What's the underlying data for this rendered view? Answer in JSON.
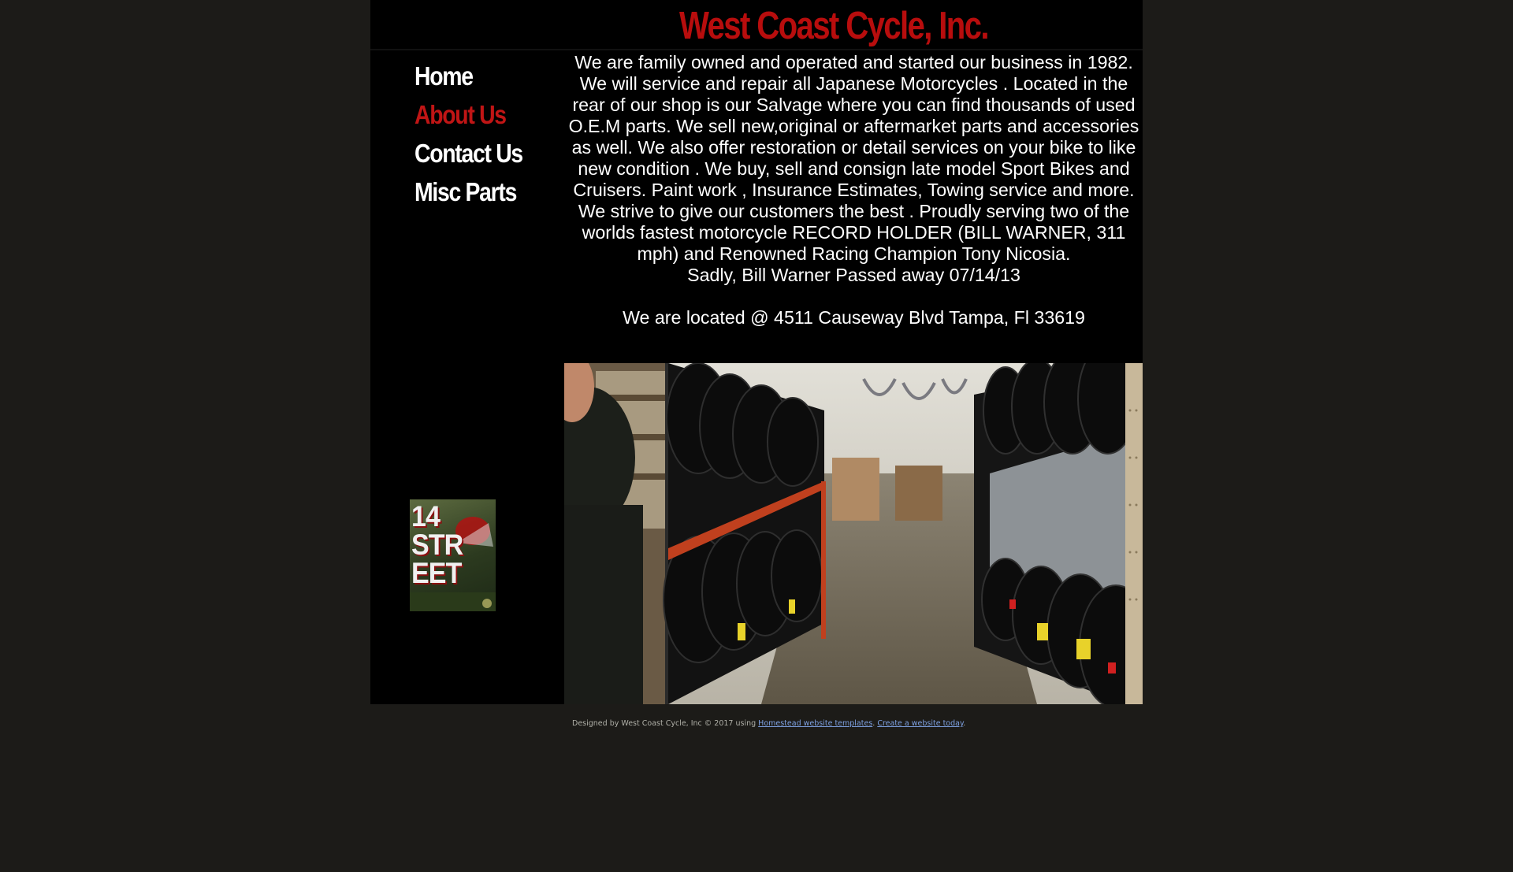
{
  "header": {
    "site_title": "West Coast Cycle, Inc."
  },
  "nav": {
    "items": [
      {
        "label": "Home",
        "active": false
      },
      {
        "label": "About Us",
        "active": true
      },
      {
        "label": "Contact Us",
        "active": false
      },
      {
        "label": "Misc Parts",
        "active": false
      }
    ]
  },
  "about": {
    "paragraph": "We are family owned and operated and  started our business in 1982. We will service and repair all Japanese Motorcycles .  Located in the rear of our shop is our Salvage  where you can find thousands of used O.E.M parts. We sell new,original or aftermarket parts and accessories as well. We also offer  restoration or detail services on your bike to like new condition . We buy, sell  and consign late model Sport Bikes and Cruisers.   Paint work , Insurance Estimates, Towing service and more.  We strive to give our customers the best .  Proudly serving two of the worlds fastest motorcycle RECORD HOLDER (BILL WARNER, 311 mph) and Renowned Racing Champion Tony Nicosia.",
    "memorial": "Sadly, Bill Warner Passed away 07/14/13",
    "location": "We are located @ 4511 Causeway Blvd Tampa, Fl 33619"
  },
  "badge": {
    "text": "14 STR EET"
  },
  "footer": {
    "prefix": "Designed by West Coast Cycle, Inc © 2017 using ",
    "link1": "Homestead website templates",
    "separator": ". ",
    "link2": "Create a website today",
    "suffix": "."
  },
  "colors": {
    "page_background": "#1c1b18",
    "content_background": "#000000",
    "title_red": "#b80d0d",
    "active_nav_red": "#c01515",
    "link_blue": "#7da0e0"
  }
}
